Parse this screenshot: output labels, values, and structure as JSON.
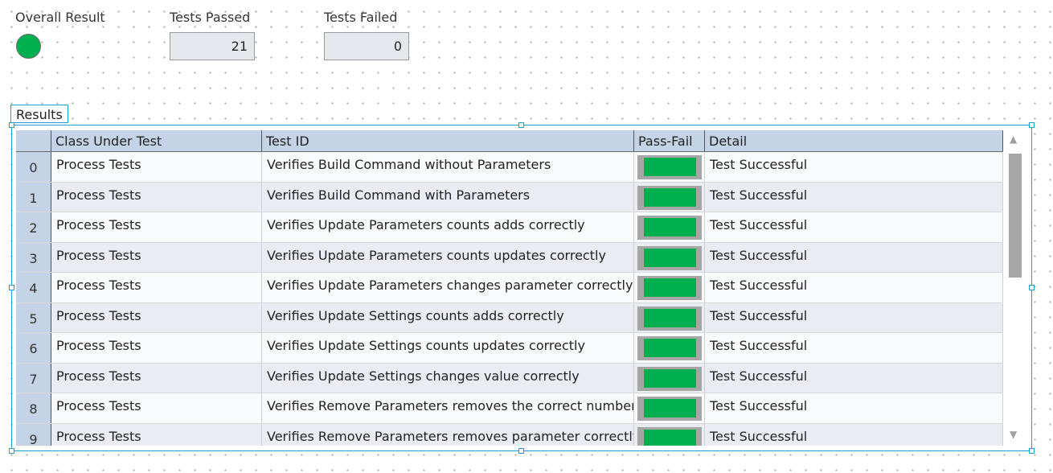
{
  "indicators": {
    "overall_result_label": "Overall Result",
    "overall_result_color": "#00b050",
    "tests_passed_label": "Tests Passed",
    "tests_passed_value": "21",
    "tests_failed_label": "Tests Failed",
    "tests_failed_value": "0"
  },
  "results": {
    "label": "Results",
    "columns": [
      "Class Under Test",
      "Test ID",
      "Pass-Fail",
      "Detail"
    ],
    "pass_color": "#00b050",
    "rows": [
      {
        "index": "0",
        "class": "Process Tests",
        "test_id": "Verifies Build Command without Parameters",
        "pass": true,
        "detail": "Test Successful"
      },
      {
        "index": "1",
        "class": "Process Tests",
        "test_id": "Verifies Build Command with Parameters",
        "pass": true,
        "detail": "Test Successful"
      },
      {
        "index": "2",
        "class": "Process Tests",
        "test_id": "Verifies Update Parameters counts adds correctly",
        "pass": true,
        "detail": "Test Successful"
      },
      {
        "index": "3",
        "class": "Process Tests",
        "test_id": "Verifies Update Parameters counts updates correctly",
        "pass": true,
        "detail": "Test Successful"
      },
      {
        "index": "4",
        "class": "Process Tests",
        "test_id": "Verifies Update Parameters changes parameter correctly",
        "pass": true,
        "detail": "Test Successful"
      },
      {
        "index": "5",
        "class": "Process Tests",
        "test_id": "Verifies Update Settings counts adds correctly",
        "pass": true,
        "detail": "Test Successful"
      },
      {
        "index": "6",
        "class": "Process Tests",
        "test_id": "Verifies Update Settings counts updates correctly",
        "pass": true,
        "detail": "Test Successful"
      },
      {
        "index": "7",
        "class": "Process Tests",
        "test_id": "Verifies Update Settings changes value correctly",
        "pass": true,
        "detail": "Test Successful"
      },
      {
        "index": "8",
        "class": "Process Tests",
        "test_id": "Verifies Remove Parameters removes the correct number",
        "pass": true,
        "detail": "Test Successful"
      },
      {
        "index": "9",
        "class": "Process Tests",
        "test_id": "Verifies Remove Parameters removes parameter correctly",
        "pass": true,
        "detail": "Test Successful"
      }
    ]
  }
}
